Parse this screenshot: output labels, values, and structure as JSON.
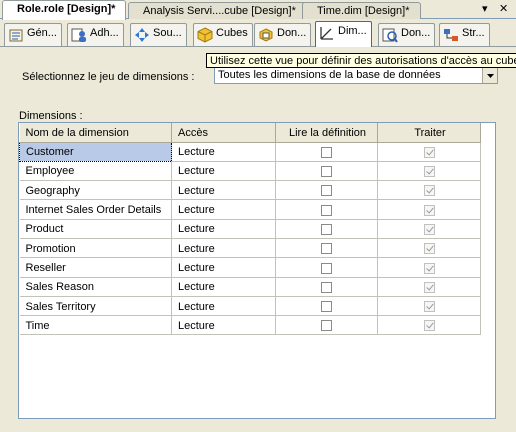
{
  "document_tabs": [
    {
      "label": "Role.role [Design]*",
      "active": true
    },
    {
      "label": "Analysis Servi....cube [Design]*",
      "active": false
    },
    {
      "label": "Time.dim [Design]*",
      "active": false
    }
  ],
  "window_controls": {
    "dropdown": "▾",
    "close": "✕"
  },
  "designer_tabs": [
    {
      "label": "Gén...",
      "icon": "general-icon"
    },
    {
      "label": "Adh...",
      "icon": "membership-icon"
    },
    {
      "label": "Sou...",
      "icon": "data-sources-icon"
    },
    {
      "label": "Cubes",
      "icon": "cubes-icon"
    },
    {
      "label": "Don...",
      "icon": "cell-data-icon"
    },
    {
      "label": "Dim...",
      "icon": "dimensions-icon"
    },
    {
      "label": "Don...",
      "icon": "dimension-data-icon"
    },
    {
      "label": "Str...",
      "icon": "mining-structures-icon"
    }
  ],
  "tooltip": "Utilisez cette vue pour définir des autorisations d'accès au cube.",
  "dimension_set": {
    "label": "Sélectionnez le jeu de dimensions :",
    "value": "Toutes les dimensions de la base de données"
  },
  "dimensions_label": "Dimensions :",
  "grid": {
    "columns": [
      "Nom de la dimension",
      "Accès",
      "Lire la définition",
      "Traiter"
    ],
    "rows": [
      {
        "name": "Customer",
        "access": "Lecture",
        "read_definition": false,
        "process": true
      },
      {
        "name": "Employee",
        "access": "Lecture",
        "read_definition": false,
        "process": true
      },
      {
        "name": "Geography",
        "access": "Lecture",
        "read_definition": false,
        "process": true
      },
      {
        "name": "Internet Sales Order Details",
        "access": "Lecture",
        "read_definition": false,
        "process": true
      },
      {
        "name": "Product",
        "access": "Lecture",
        "read_definition": false,
        "process": true
      },
      {
        "name": "Promotion",
        "access": "Lecture",
        "read_definition": false,
        "process": true
      },
      {
        "name": "Reseller",
        "access": "Lecture",
        "read_definition": false,
        "process": true
      },
      {
        "name": "Sales Reason",
        "access": "Lecture",
        "read_definition": false,
        "process": true
      },
      {
        "name": "Sales Territory",
        "access": "Lecture",
        "read_definition": false,
        "process": true
      },
      {
        "name": "Time",
        "access": "Lecture",
        "read_definition": false,
        "process": true
      }
    ],
    "selected_row": 0
  }
}
